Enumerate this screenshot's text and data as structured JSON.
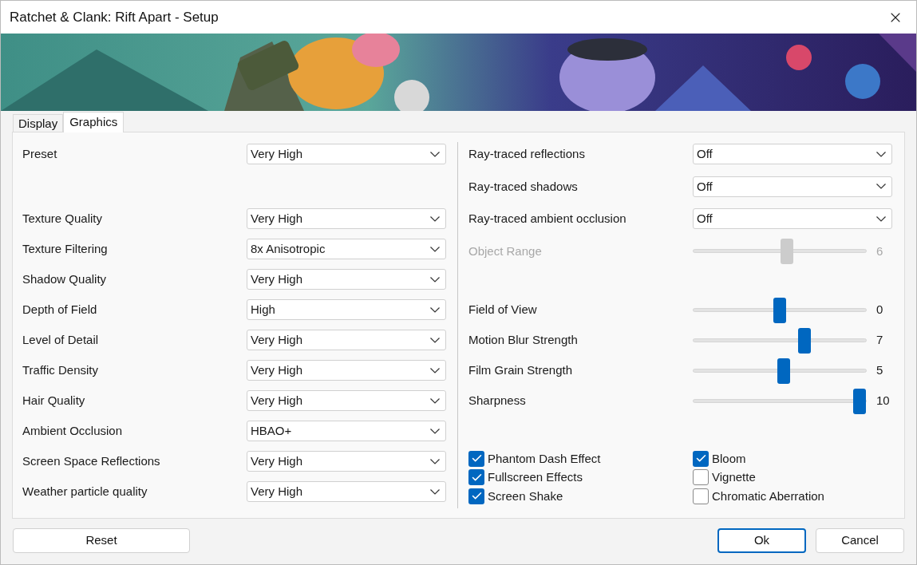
{
  "window": {
    "title": "Ratchet & Clank: Rift Apart - Setup"
  },
  "tabs": [
    {
      "label": "Display",
      "selected": false
    },
    {
      "label": "Graphics",
      "selected": true
    }
  ],
  "preset": {
    "label": "Preset",
    "value": "Very High"
  },
  "quality_settings": [
    {
      "label": "Texture Quality",
      "value": "Very High"
    },
    {
      "label": "Texture Filtering",
      "value": "8x Anisotropic"
    },
    {
      "label": "Shadow Quality",
      "value": "Very High"
    },
    {
      "label": "Depth of Field",
      "value": "High"
    },
    {
      "label": "Level of Detail",
      "value": "Very High"
    },
    {
      "label": "Traffic Density",
      "value": "Very High"
    },
    {
      "label": "Hair Quality",
      "value": "Very High"
    },
    {
      "label": "Ambient Occlusion",
      "value": "HBAO+"
    },
    {
      "label": "Screen Space Reflections",
      "value": "Very High"
    },
    {
      "label": "Weather particle quality",
      "value": "Very High"
    }
  ],
  "ray_tracing": [
    {
      "label": "Ray-traced reflections",
      "value": "Off"
    },
    {
      "label": "Ray-traced shadows",
      "value": "Off"
    },
    {
      "label": "Ray-traced ambient occlusion",
      "value": "Off"
    }
  ],
  "object_range": {
    "label": "Object Range",
    "disabled": true,
    "level": 0.545,
    "reading": "6"
  },
  "sliders": [
    {
      "label": "Field of View",
      "disabled": false,
      "level": 0.5,
      "reading": "0"
    },
    {
      "label": "Motion Blur Strength",
      "disabled": false,
      "level": 0.655,
      "reading": "7"
    },
    {
      "label": "Film Grain Strength",
      "disabled": false,
      "level": 0.525,
      "reading": "5"
    },
    {
      "label": "Sharpness",
      "disabled": false,
      "level": 1.0,
      "reading": "10"
    }
  ],
  "effects": [
    {
      "label": "Phantom Dash Effect",
      "checked": true
    },
    {
      "label": "Fullscreen Effects",
      "checked": true
    },
    {
      "label": "Screen Shake",
      "checked": true
    },
    {
      "label": "Bloom",
      "checked": true
    },
    {
      "label": "Vignette",
      "checked": false
    },
    {
      "label": "Chromatic Aberration",
      "checked": false
    }
  ],
  "buttons": [
    {
      "label": "Reset",
      "default": false
    },
    {
      "label": "Ok",
      "default": true
    },
    {
      "label": "Cancel",
      "default": false
    }
  ]
}
